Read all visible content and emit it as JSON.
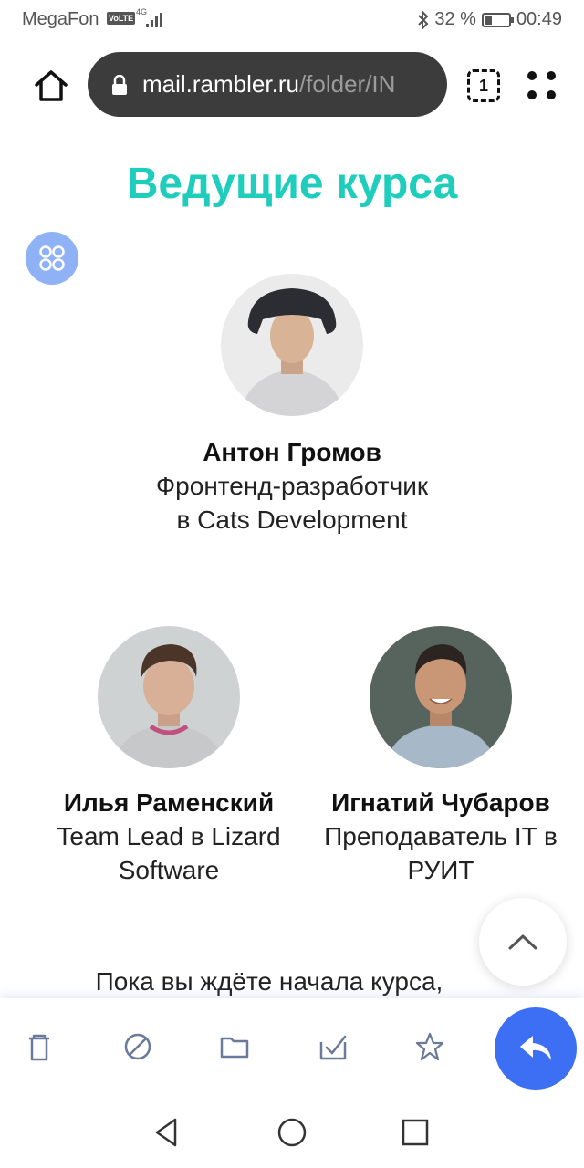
{
  "status_bar": {
    "carrier": "MegaFon",
    "volte": "VoLTE",
    "network": "4G",
    "battery_text": "32 %",
    "battery_level": 0.32,
    "time": "00:49"
  },
  "browser": {
    "url_host": "mail.rambler.ru",
    "url_path": "/folder/IN",
    "tab_count": "1"
  },
  "email": {
    "heading": "Ведущие курса",
    "heading_color": "#1fcdbd",
    "instructors": [
      {
        "name": "Антон Громов",
        "role": "Фронтенд-разработчик в Cats Development"
      },
      {
        "name": "Илья Раменский",
        "role": "Team Lead в Lizard Software"
      },
      {
        "name": "Игнатий Чубаров",
        "role": "Преподаватель IT в РУИТ"
      }
    ],
    "intro_text": "Пока вы ждёте начала курса,"
  },
  "icons": {
    "apps": "apps-grid-icon",
    "scroll_up": "chevron-up-icon",
    "toolbar": [
      "trash-icon",
      "spam-block-icon",
      "folder-icon",
      "mark-read-icon",
      "star-icon"
    ],
    "reply": "reply-icon"
  },
  "colors": {
    "accent_blue": "#3d6ff5",
    "apps_button": "#8fb2f7",
    "url_bar": "#3c3c3c"
  }
}
